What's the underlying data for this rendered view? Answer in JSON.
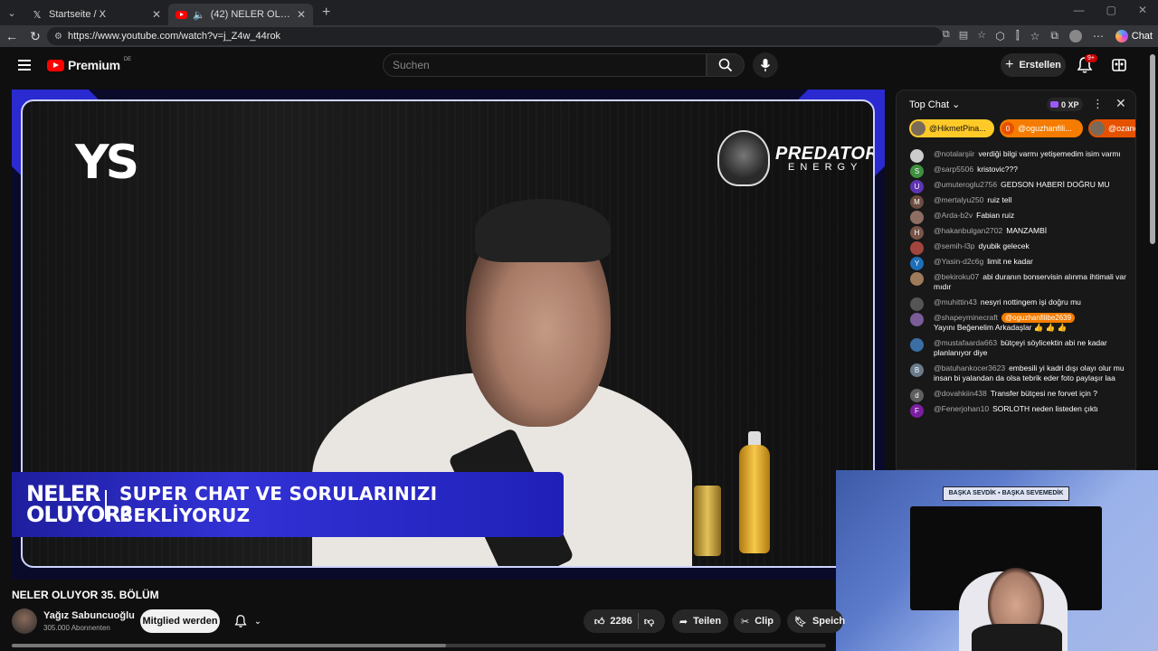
{
  "browser": {
    "tabs": [
      {
        "title": "Startseite / X",
        "active": false
      },
      {
        "title": "(42) NELER OLUYOR 35. BÖLÜM",
        "active": true
      }
    ],
    "url": "https://www.youtube.com/watch?v=j_Z4w_44rok",
    "chat_button": "Chat"
  },
  "yt_header": {
    "logo_text": "Premium",
    "logo_region": "DE",
    "search_placeholder": "Suchen",
    "create_label": "Erstellen",
    "notification_count": "9+"
  },
  "video": {
    "channel_logo": "YS",
    "sponsor_line1": "PREDATOR",
    "sponsor_line2": "ENERGY",
    "banner_logo": "NELER OLUYOR?",
    "banner_text": "SUPER CHAT VE SORULARINIZI BEKLİYORUZ",
    "webcam_label": "BAŞKA SEVDİK ▪ BAŞKA SEVEMEDİK"
  },
  "video_info": {
    "title": "NELER OLUYOR 35. BÖLÜM",
    "channel_name": "Yağız Sabuncuoğlu",
    "subscribers": "305.000 Abonnenten",
    "join_label": "Mitglied werden",
    "like_count": "2286",
    "share_label": "Teilen",
    "clip_label": "Clip",
    "save_label": "Speich"
  },
  "chat": {
    "title": "Top Chat",
    "xp": "0 XP",
    "tickers": [
      {
        "name": "@HikmetPina..."
      },
      {
        "name": "@oguzhanfili...",
        "badge": "0"
      },
      {
        "name": "@ozanc"
      }
    ],
    "messages": [
      {
        "user": "@notalarşiir",
        "text": "verdiği bilgi varmı yetişemedim isim varmı",
        "initial": "",
        "color": "#cccccc"
      },
      {
        "user": "@sarp5506",
        "text": "kristovic???",
        "initial": "S",
        "color": "#3f8f3f"
      },
      {
        "user": "@umuteroglu2756",
        "text": "GEDSON HABERİ DOĞRU MU",
        "initial": "U",
        "color": "#5e35b1"
      },
      {
        "user": "@mertalyu250",
        "text": "ruiz tell",
        "initial": "M",
        "color": "#6d4c41"
      },
      {
        "user": "@Arda-b2v",
        "text": "Fabian ruiz",
        "initial": "",
        "color": "#8d6e63"
      },
      {
        "user": "@hakanbulgan2702",
        "text": "MANZAMBİ",
        "initial": "H",
        "color": "#795548"
      },
      {
        "user": "@semih-l3p",
        "text": "dyubik gelecek",
        "initial": "",
        "color": "#a1453f"
      },
      {
        "user": "@Yasin-d2c6g",
        "text": "limit ne kadar",
        "initial": "Y",
        "color": "#1e6fb8"
      },
      {
        "user": "@bekiroku07",
        "text": "abi duranın bonservisin alınma ihtimali var mıdır",
        "initial": "",
        "color": "#9e7b5a"
      },
      {
        "user": "@muhittin43",
        "text": "nesyri nottingem işi doğru mu",
        "initial": "",
        "color": "#555555"
      },
      {
        "user": "@shapeyminecraft",
        "text": "Yayını Beğenelim Arkadaşlar 👍 👍 👍",
        "mention": "@oguzhanfilibe2639",
        "initial": "",
        "color": "#7a5c99"
      },
      {
        "user": "@mustafaarda663",
        "text": "bütçeyi söylicektin abi ne kadar planlanıyor diye",
        "initial": "",
        "color": "#3a6ea5"
      },
      {
        "user": "@batuhankocer3623",
        "text": "embesili yi kadri dışı olayı olur mu insan bi yalandan da olsa tebrik eder foto paylaşır laa",
        "initial": "B",
        "color": "#6a7b8a"
      },
      {
        "user": "@dovahkiin438",
        "text": "Transfer bütçesi ne forvet için ?",
        "initial": "d",
        "color": "#5f5f5f"
      },
      {
        "user": "@Fenerjohan10",
        "text": "SORLOTH neden listeden çıktı",
        "initial": "F",
        "color": "#7b1fa2"
      }
    ]
  },
  "colors": {
    "accent_red": "#ff0000",
    "banner_blue": "#2b2bd0",
    "ticker_gold": "#ffca28",
    "ticker_orange": "#f57c00"
  }
}
